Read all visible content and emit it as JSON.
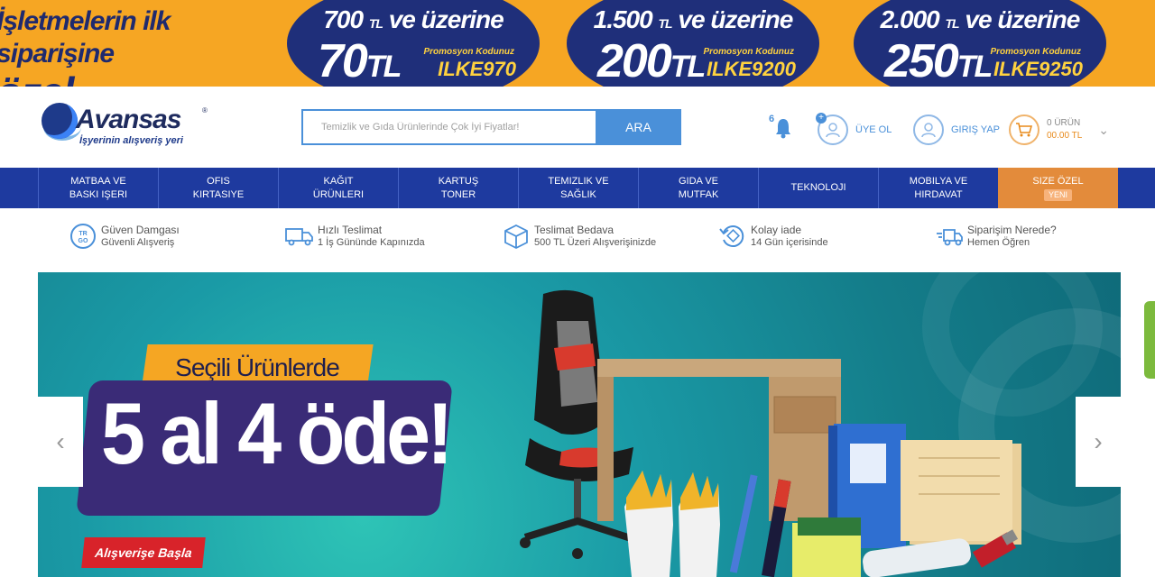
{
  "promo": {
    "left_line1": "İşletmelerin ilk siparişine",
    "left_line2": "özel indirimler!",
    "cards": [
      {
        "threshold": "700",
        "unit": "TL",
        "suffix": "ve üzerine",
        "amount": "70",
        "amount_unit": "TL",
        "code_label": "Promosyon Kodunuz",
        "code": "ILKE970"
      },
      {
        "threshold": "1.500",
        "unit": "TL",
        "suffix": "ve üzerine",
        "amount": "200",
        "amount_unit": "TL",
        "code_label": "Promosyon Kodunuz",
        "code": "ILKE9200"
      },
      {
        "threshold": "2.000",
        "unit": "TL",
        "suffix": "ve üzerine",
        "amount": "250",
        "amount_unit": "TL",
        "code_label": "Promosyon Kodunuz",
        "code": "ILKE9250"
      }
    ]
  },
  "header": {
    "logo_name": "Avansas",
    "logo_reg": "®",
    "logo_tagline": "İşyerinin alışveriş yeri",
    "search_placeholder": "Temizlik ve Gıda Ürünlerinde Çok İyi Fiyatlar!",
    "search_button": "ARA",
    "notification_count": "6",
    "signup": "ÜYE OL",
    "login": "GIRIŞ YAP",
    "cart_count": "0 ÜRÜN",
    "cart_total": "00.00 TL"
  },
  "nav": {
    "items": [
      {
        "line1": "MATBAA VE",
        "line2": "BASKI IŞERI"
      },
      {
        "line1": "OFIS",
        "line2": "KIRTASIYE"
      },
      {
        "line1": "KAĞIT",
        "line2": "ÜRÜNLERI"
      },
      {
        "line1": "KARTUŞ",
        "line2": "TONER"
      },
      {
        "line1": "TEMIZLIK VE",
        "line2": "SAĞLIK"
      },
      {
        "line1": "GIDA VE",
        "line2": "MUTFAK"
      },
      {
        "line1": "TEKNOLOJI",
        "line2": ""
      },
      {
        "line1": "MOBILYA VE",
        "line2": "HIRDAVAT"
      }
    ],
    "special": {
      "label": "SIZE ÖZEL",
      "badge": "YENI"
    }
  },
  "features": [
    {
      "title": "Güven Damgası",
      "subtitle": "Güvenli Alışveriş",
      "icon": "trust-seal-icon"
    },
    {
      "title": "Hızlı Teslimat",
      "subtitle": "1 İş Gününde Kapınızda",
      "icon": "truck-icon"
    },
    {
      "title": "Teslimat Bedava",
      "subtitle": "500 TL Üzeri Alışverişinizde",
      "icon": "box-icon"
    },
    {
      "title": "Kolay iade",
      "subtitle": "14 Gün içerisinde",
      "icon": "return-icon"
    },
    {
      "title": "Siparişim Nerede?",
      "subtitle": "Hemen Öğren",
      "icon": "delivery-icon"
    }
  ],
  "banner": {
    "tag": "Seçili Ürünlerde",
    "headline": "5 al 4 öde!",
    "cta": "Alışverişe Başla"
  },
  "colors": {
    "promo_bg": "#f6a623",
    "nav_bg": "#1e3a9f",
    "accent_blue": "#4a90d9",
    "special_orange": "#e38b3b"
  }
}
